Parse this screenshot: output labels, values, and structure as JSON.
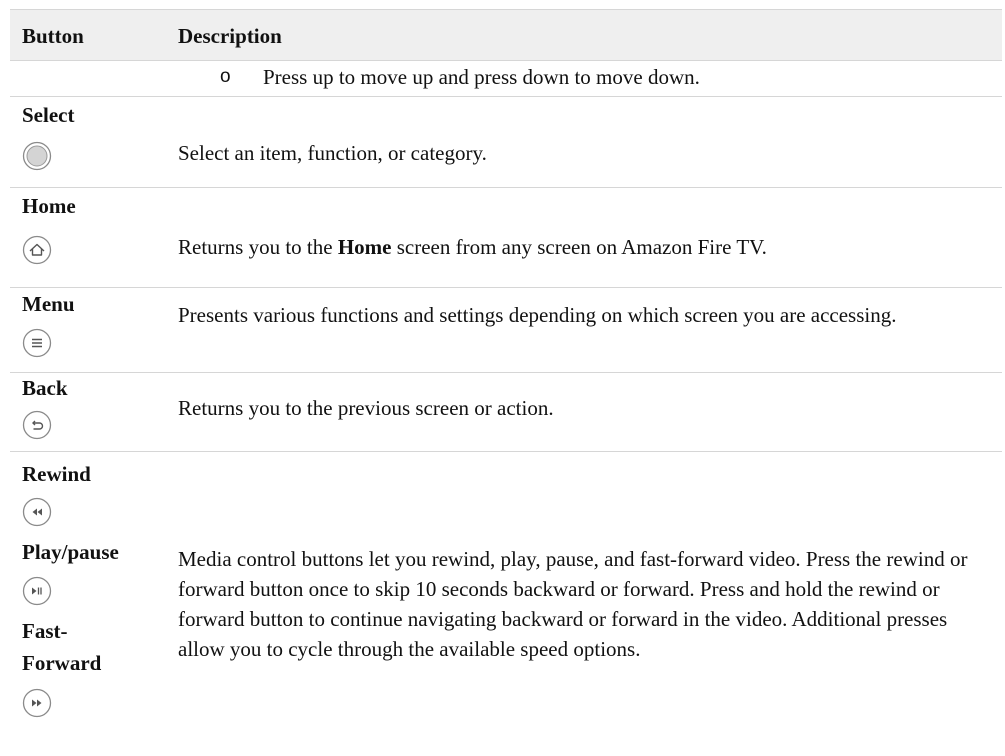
{
  "header": {
    "button": "Button",
    "description": "Description"
  },
  "bullet": {
    "marker": "o",
    "text": "Press up to move up and press down to move down."
  },
  "rows": {
    "select": {
      "label": "Select",
      "icon": "select-circle-icon",
      "description": "Select an item, function, or category."
    },
    "home": {
      "label": "Home",
      "icon": "home-icon",
      "description_pre": "Returns you to the ",
      "description_bold": "Home",
      "description_post": " screen from any screen on Amazon Fire TV."
    },
    "menu": {
      "label": "Menu",
      "icon": "menu-icon",
      "description": "Presents various functions and settings depending on which screen you are accessing."
    },
    "back": {
      "label": "Back",
      "icon": "back-icon",
      "description": "Returns you to the previous screen or action."
    },
    "media": {
      "rewind_label": "Rewind",
      "rewind_icon": "rewind-icon",
      "playpause_label": "Play/pause",
      "playpause_icon": "play-pause-icon",
      "ff_label_1": "Fast-",
      "ff_label_2": "Forward",
      "ff_icon": "fast-forward-icon",
      "description": "Media control buttons let you rewind, play, pause, and fast-forward video. Press the rewind or forward button once to skip 10 seconds backward or forward. Press and hold the rewind or forward button to continue navigating backward or forward in the video. Additional presses allow you to cycle through the available speed options."
    }
  }
}
